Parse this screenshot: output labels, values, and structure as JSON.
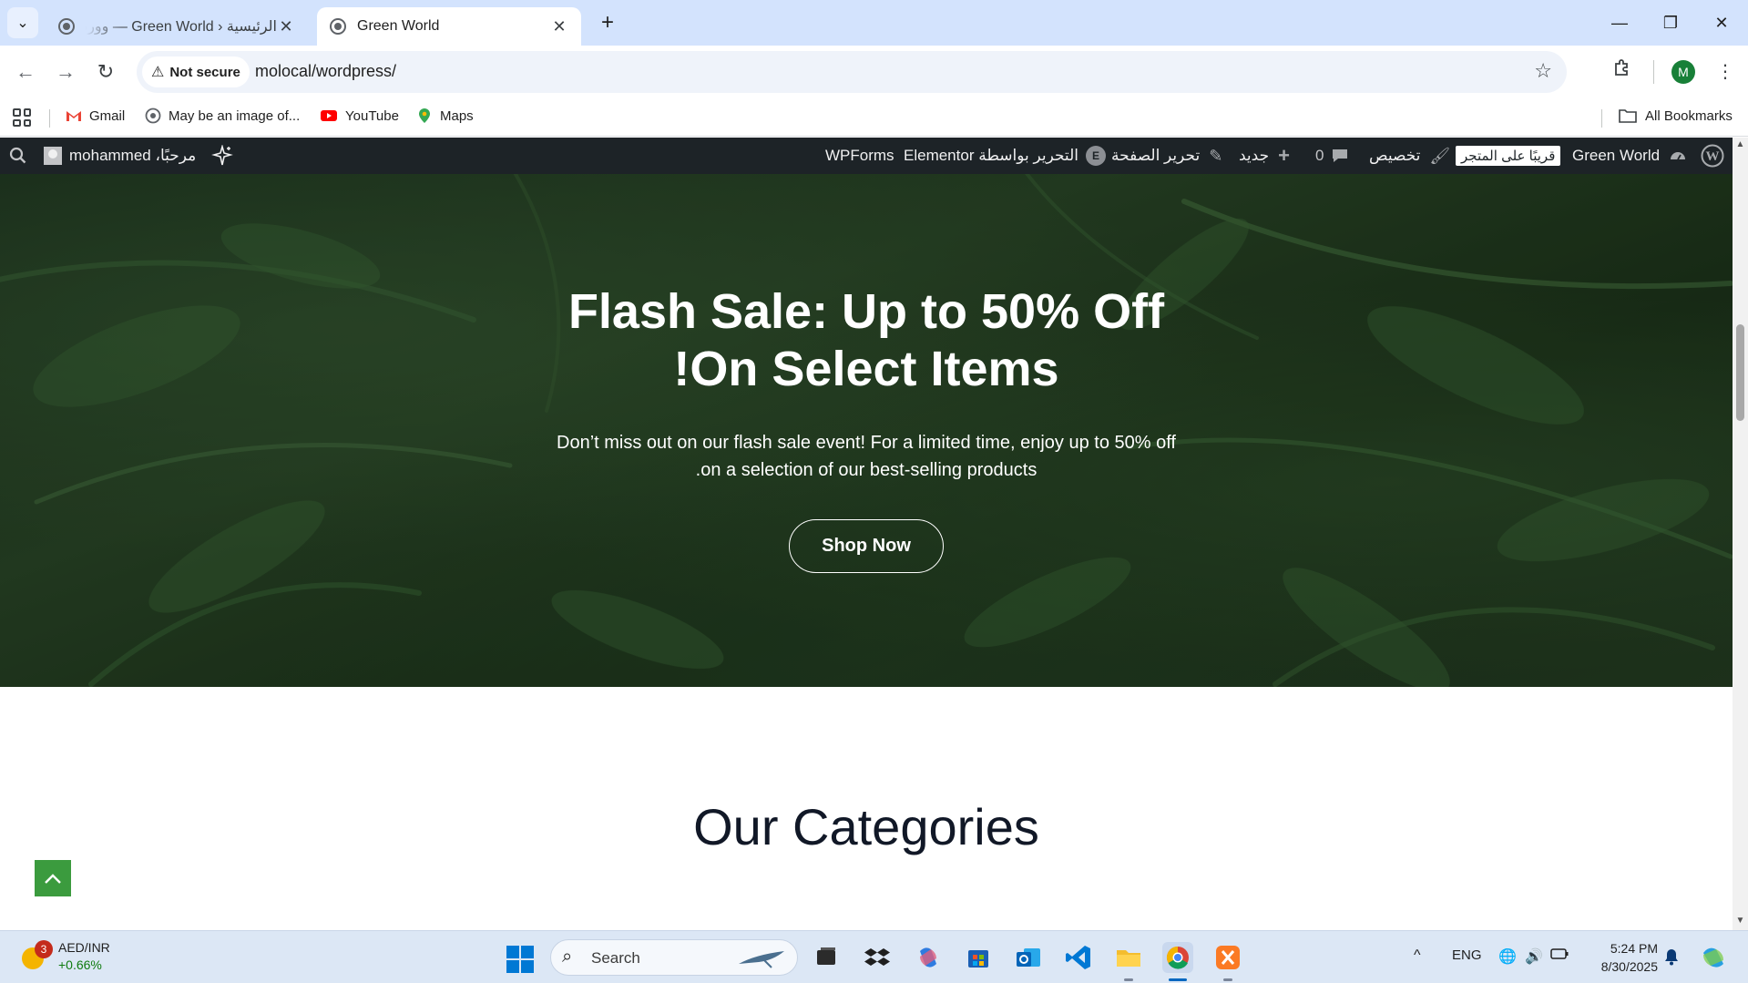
{
  "browser": {
    "tabs": [
      {
        "title": "الرئيسية ‹ Green World — ووردبريس",
        "active": false
      },
      {
        "title": "Green World",
        "active": true
      }
    ],
    "security_label": "Not secure",
    "url": "molocal/wordpress/",
    "profile_initial": "M",
    "bookmarks": [
      {
        "label": "Gmail",
        "icon": "gmail-icon"
      },
      {
        "label": "May be an image of...",
        "icon": "globe-icon"
      },
      {
        "label": "YouTube",
        "icon": "youtube-icon"
      },
      {
        "label": "Maps",
        "icon": "maps-icon"
      }
    ],
    "all_bookmarks": "All Bookmarks"
  },
  "admin_bar": {
    "site_name": "Green World",
    "coming_soon": "قريبًا على المتجر",
    "customize": "تخصيص",
    "comments_count": "0",
    "new_label": "جديد",
    "edit_page": "تحرير الصفحة",
    "edit_elementor": "التحرير بواسطة Elementor",
    "wpforms": "WPForms",
    "greeting": "مرحبًا، mohammed"
  },
  "hero": {
    "title_line1": "Flash Sale: Up to 50% Off",
    "title_line2": "!On Select Items",
    "text_line1": "Don’t miss out on our flash sale event! For a limited time, enjoy up to 50% off",
    "text_line2": ".on a selection of our best-selling products",
    "button": "Shop Now"
  },
  "categories": {
    "title": "Our Categories"
  },
  "taskbar": {
    "ticker_symbol": "AED/INR",
    "ticker_change": "+0.66%",
    "weather_badge": "3",
    "search_placeholder": "Search",
    "language": "ENG",
    "time": "5:24 PM",
    "date": "8/30/2025"
  },
  "colors": {
    "chrome_tab_strip": "#d3e3fd",
    "wp_admin_bar": "#1d2327",
    "hero_button_border": "#ffffff",
    "to_top_button": "#3b9b3e",
    "categories_title": "#111827"
  }
}
